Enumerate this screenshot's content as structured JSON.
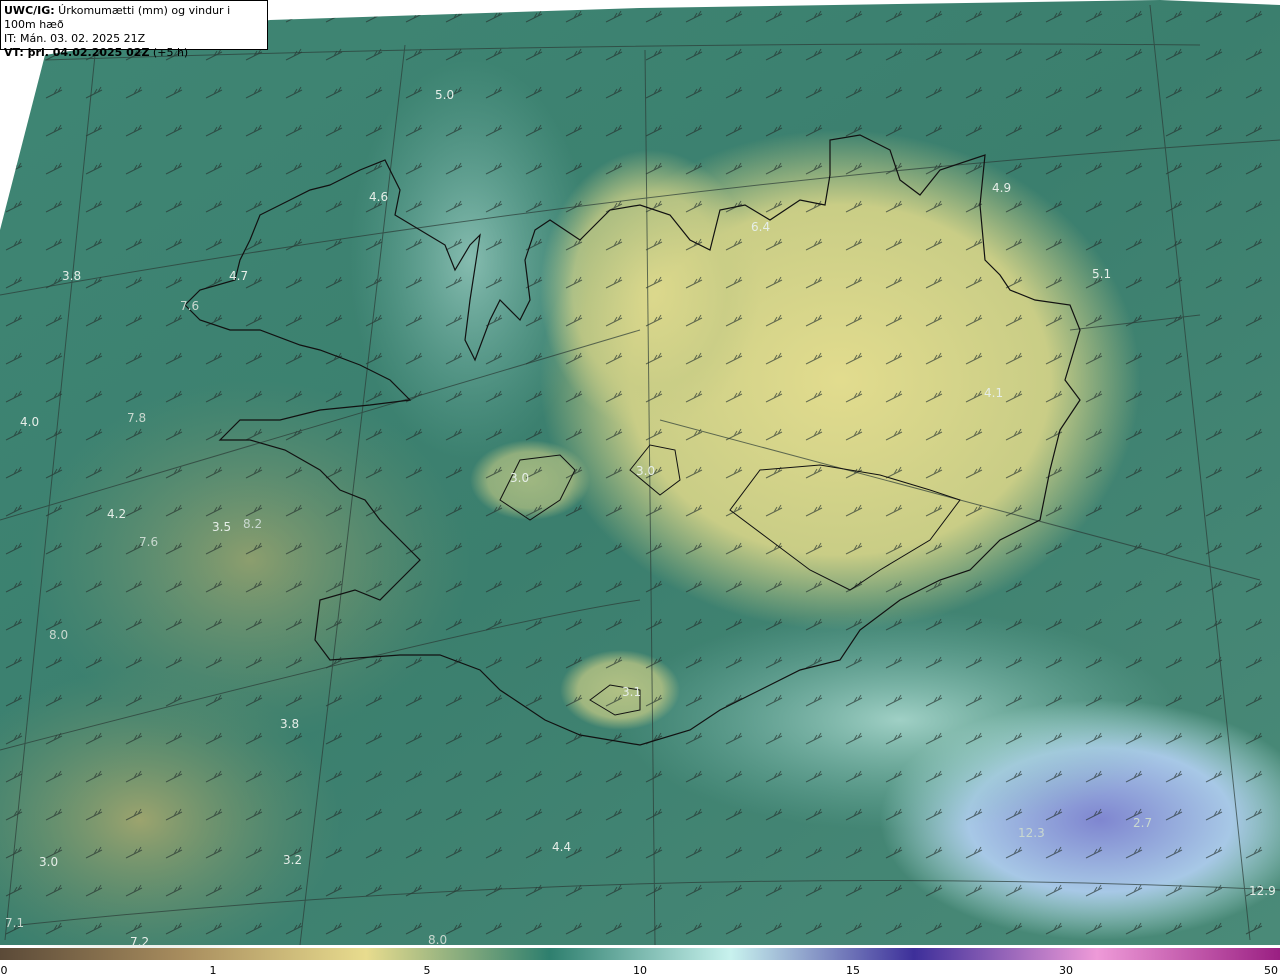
{
  "header": {
    "line1_key": "UWC/IG:",
    "line1_text": " Úrkomumætti (mm) og vindur i 100m hæð",
    "line2": "IT: Mán. 03. 02. 2025 21Z",
    "line3_key": "VT: þri. 04.02.2025 02Z",
    "line3_text": " (+5 h)"
  },
  "map_values": [
    "5.0",
    "4.6",
    "4.9",
    "6.4",
    "3.8",
    "4.7",
    "7.6",
    "5.1",
    "4.0",
    "7.8",
    "4.1",
    "3.0",
    "3.0",
    "4.2",
    "3.5",
    "8.2",
    "7.6",
    "8.0",
    "3.1",
    "3.8",
    "12.3",
    "2.7",
    "3.0",
    "3.2",
    "4.4",
    "12.9",
    "7.1",
    "7.2",
    "8.0"
  ],
  "colorbar": {
    "ticks": [
      "0",
      "1",
      "5",
      "10",
      "15",
      "30",
      "50"
    ],
    "stops": [
      "#5b4a38",
      "#a88d5e",
      "#e8dc8e",
      "#2e7f6e",
      "#c8f2ee",
      "#3d2f9a",
      "#ee9ad8",
      "#9a1f82"
    ]
  },
  "colors": {
    "sea_dark": "#3a7d6c",
    "sea_mid": "#4e9080",
    "light_band": "#9fd4c9",
    "yellow_region": "#d9d487",
    "olive_region": "#8fa068",
    "blue_region": "#8e9ad6"
  }
}
